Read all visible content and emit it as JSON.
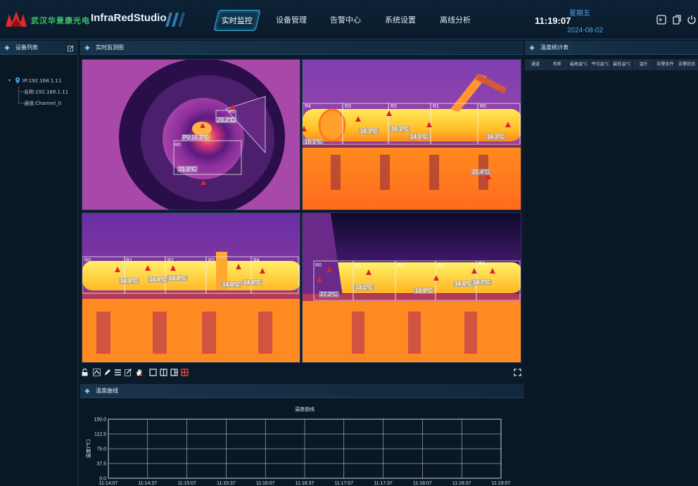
{
  "header": {
    "company": "武汉华景康光电",
    "app_name": "InfraRedStudio",
    "tabs": [
      {
        "label": "实时监控",
        "active": true
      },
      {
        "label": "设备管理",
        "active": false
      },
      {
        "label": "告警中心",
        "active": false
      },
      {
        "label": "系统设置",
        "active": false
      },
      {
        "label": "离线分析",
        "active": false
      }
    ],
    "time": "11:19:07",
    "weekday": "星期五",
    "date": "2024-08-02",
    "icons": [
      "terminal-icon",
      "copy-icon",
      "power-icon"
    ],
    "colors": {
      "accent": "#3fb2d6",
      "logo": "#e0292c",
      "brand_green": "#3ec46b"
    }
  },
  "device_panel": {
    "title": "设备列表",
    "tree": {
      "ip": "IP:192.168.1.11",
      "name": "名称:192.168.1.11",
      "channel": "通道:Channel_0"
    }
  },
  "monitor_panel": {
    "title": "实时监测图",
    "cells": [
      {
        "regions": [
          {
            "label": "R0",
            "temp": "21.5°C"
          },
          {
            "label": "R0",
            "temp": "20.2°C"
          },
          {
            "label": "P0",
            "temp": "15.3°C"
          }
        ]
      },
      {
        "regions": [
          {
            "label": "R4",
            "temp": "16.1°C"
          },
          {
            "label": "R3",
            "temp": "16.3°C"
          },
          {
            "label": "R2",
            "temp": "15.1°C"
          },
          {
            "label": "R1",
            "temp": "14.5°C"
          },
          {
            "label": "R0",
            "temp": "16.3°C"
          },
          {
            "label": "",
            "temp": "21.4°C"
          }
        ]
      },
      {
        "regions": [
          {
            "label": "R0",
            "temp": "14.9°C"
          },
          {
            "label": "R1",
            "temp": "14.9°C"
          },
          {
            "label": "R2",
            "temp": "14.8°C"
          },
          {
            "label": "R3",
            "temp": "14.6°C"
          },
          {
            "label": "R4",
            "temp": "14.9°C"
          }
        ]
      },
      {
        "regions": [
          {
            "label": "R0",
            "temp": "27.2°C"
          },
          {
            "label": "R1",
            "temp": "13.1°C"
          },
          {
            "label": "R2",
            "temp": "13.9°C"
          },
          {
            "label": "R3",
            "temp": "14.6°C"
          },
          {
            "label": "R4",
            "temp": "14.7°C"
          }
        ]
      }
    ],
    "toolbar_icons": [
      "unlock-icon",
      "mountain-icon",
      "pen-icon",
      "list-icon",
      "edit-icon",
      "hand-icon",
      "layout-1-icon",
      "layout-2-icon",
      "layout-3-icon",
      "layout-4-icon"
    ],
    "fullscreen_icon": "fullscreen-icon"
  },
  "stats_panel": {
    "title": "温度统计表",
    "columns": [
      "通道",
      "名称",
      "最高温°C",
      "平均温°C",
      "最低温°C",
      "温升",
      "告警条件",
      "告警状态"
    ]
  },
  "curve_panel": {
    "title": "温度曲线"
  },
  "chart_data": {
    "type": "line",
    "title": "温度曲线",
    "ylabel": "温度(℃)",
    "xlabel": "",
    "ylim": [
      0,
      150
    ],
    "yticks": [
      "0.0",
      "37.5",
      "75.0",
      "112.5",
      "150.0"
    ],
    "x": [
      "11:14:07",
      "11:14:37",
      "11:15:07",
      "11:15:37",
      "11:16:07",
      "11:16:37",
      "11:17:07",
      "11:17:37",
      "11:18:07",
      "11:18:37",
      "11:19:07"
    ],
    "series": [],
    "grid": true
  }
}
